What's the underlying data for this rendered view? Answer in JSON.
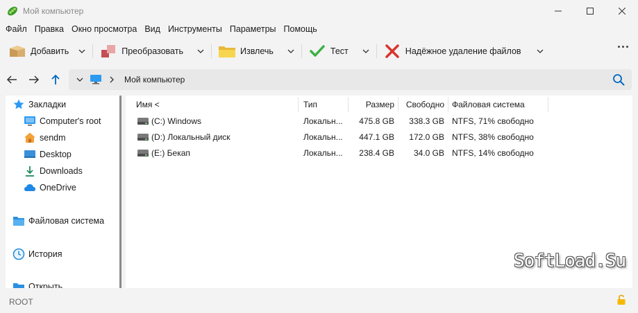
{
  "window": {
    "title": "Мой компьютер",
    "app_icon": "pea-pod-icon",
    "controls": [
      "minimize-icon",
      "maximize-icon",
      "close-icon"
    ]
  },
  "menu": [
    "Файл",
    "Правка",
    "Окно просмотра",
    "Вид",
    "Инструменты",
    "Параметры",
    "Помощь"
  ],
  "toolbar": {
    "add": {
      "label": "Добавить",
      "icon": "box-icon"
    },
    "convert": {
      "label": "Преобразовать",
      "icon": "convert-icon"
    },
    "extract": {
      "label": "Извлечь",
      "icon": "folder-icon"
    },
    "test": {
      "label": "Тест",
      "icon": "checkmark-icon"
    },
    "wipe": {
      "label": "Надёжное удаление файлов",
      "icon": "red-x-icon"
    },
    "more_icon": "more-dots-icon"
  },
  "navigation": {
    "breadcrumb_root_icon": "computer-icon",
    "path": "Мой компьютер",
    "search_icon": "search-icon"
  },
  "sidebar": {
    "bookmarks": {
      "label": "Закладки",
      "icon": "bookmark-icon"
    },
    "bookmark_items": [
      {
        "label": "Computer's root",
        "icon": "monitor-icon"
      },
      {
        "label": "sendm",
        "icon": "home-icon"
      },
      {
        "label": "Desktop",
        "icon": "desktop-icon"
      },
      {
        "label": "Downloads",
        "icon": "download-icon"
      },
      {
        "label": "OneDrive",
        "icon": "cloud-icon"
      }
    ],
    "filesystem": {
      "label": "Файловая система",
      "icon": "folder-icon"
    },
    "history": {
      "label": "История",
      "icon": "history-icon"
    },
    "open": {
      "label": "Открыть",
      "icon": "open-icon"
    }
  },
  "table": {
    "columns": {
      "name": "Имя <",
      "type": "Тип",
      "size": "Размер",
      "free": "Свободно",
      "fs": "Файловая система"
    },
    "rows": [
      {
        "name": "(C:) Windows",
        "type": "Локальн...",
        "size": "475.8 GB",
        "free": "338.3 GB",
        "fs": "NTFS, 71% свободно",
        "icon": "drive-icon"
      },
      {
        "name": "(D:) Локальный диск",
        "type": "Локальн...",
        "size": "447.1 GB",
        "free": "172.0 GB",
        "fs": "NTFS, 38% свободно",
        "icon": "drive-icon"
      },
      {
        "name": "(E:) Бекап",
        "type": "Локальн...",
        "size": "238.4 GB",
        "free": "34.0 GB",
        "fs": "NTFS, 14% свободно",
        "icon": "drive-icon"
      }
    ]
  },
  "watermark": "SoftLoad.Su",
  "status": {
    "text": "ROOT",
    "lock_icon": "lock-icon"
  },
  "colors": {
    "accent": "#0067c0",
    "window_bg": "#f3f3f3",
    "panel_bg": "#ffffff",
    "address_bg": "#e8e8e8"
  }
}
